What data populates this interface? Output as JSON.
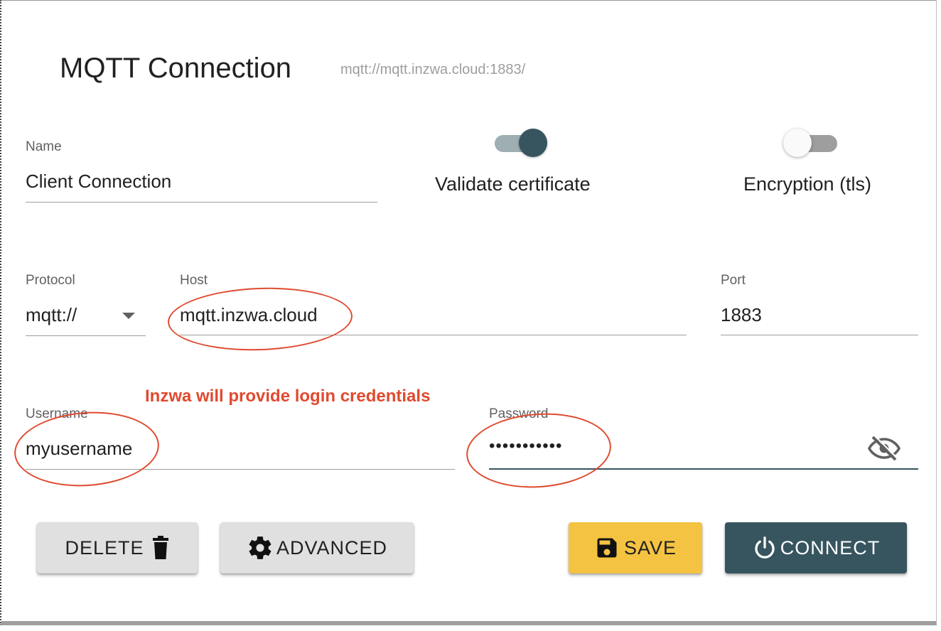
{
  "dialog": {
    "title": "MQTT Connection",
    "url": "mqtt://mqtt.inzwa.cloud:1883/"
  },
  "name_field": {
    "label": "Name",
    "value": "Client Connection"
  },
  "validate_certificate": {
    "label": "Validate certificate",
    "on": true
  },
  "encryption": {
    "label": "Encryption (tls)",
    "on": false
  },
  "protocol": {
    "label": "Protocol",
    "value": "mqtt://"
  },
  "host": {
    "label": "Host",
    "value": "mqtt.inzwa.cloud"
  },
  "port": {
    "label": "Port",
    "value": "1883"
  },
  "annotation": {
    "text": "Inzwa will provide login credentials"
  },
  "username": {
    "label": "Username",
    "value": "myusername"
  },
  "password": {
    "label": "Password",
    "value": "•••••••••••",
    "toggle_icon": "eye-off-icon"
  },
  "actions": {
    "delete_label": "DELETE",
    "advanced_label": "ADVANCED",
    "save_label": "SAVE",
    "connect_label": "CONNECT"
  },
  "colors": {
    "primary": "#37555f",
    "save": "#f5c342",
    "annotation": "#e04a2f"
  }
}
